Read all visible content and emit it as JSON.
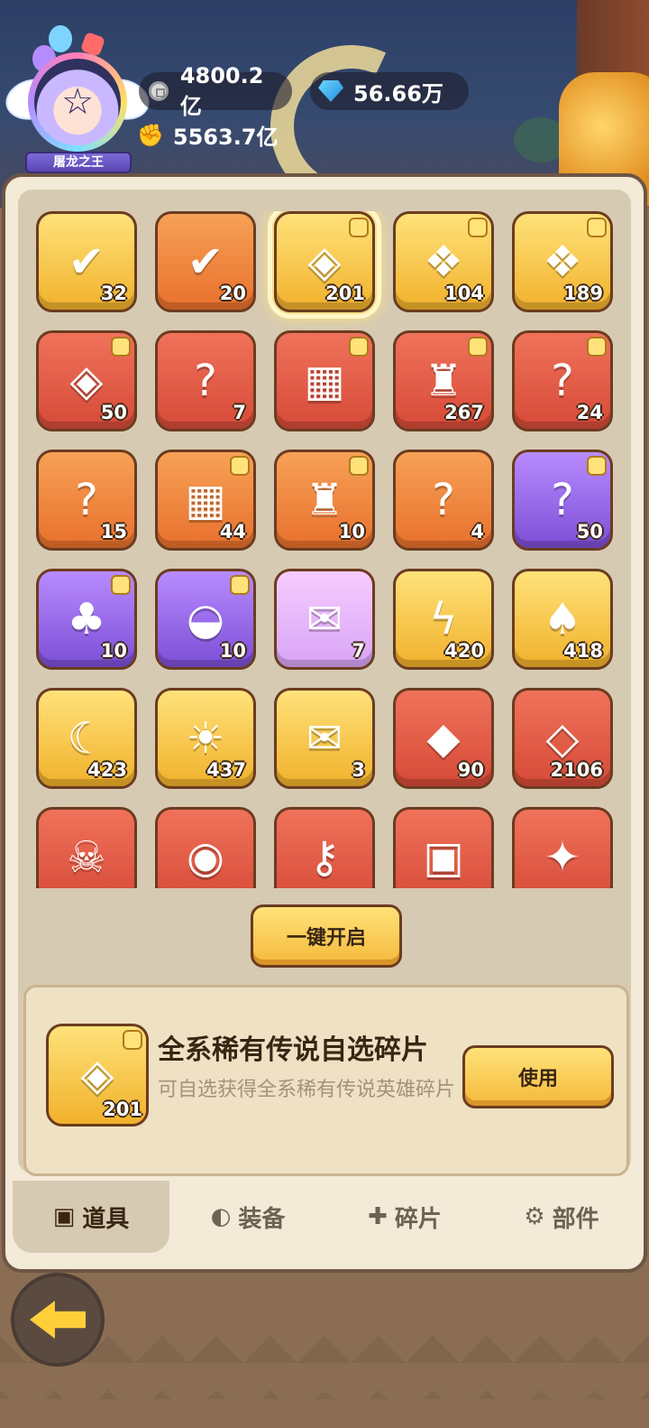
{
  "header": {
    "avatar_title": "屠龙之王",
    "coins": "4800.2亿",
    "gems": "56.66万",
    "power": "5563.7亿"
  },
  "items": [
    {
      "icon": "ticket-chest-icon",
      "count": "32",
      "color": "gold"
    },
    {
      "icon": "purple-ticket-chest-icon",
      "count": "20",
      "color": "orange"
    },
    {
      "icon": "rainbow-card-icon",
      "count": "201",
      "color": "gold",
      "selected": true
    },
    {
      "icon": "gift-box-icon",
      "count": "104",
      "color": "gold"
    },
    {
      "icon": "gift-box-icon",
      "count": "189",
      "color": "gold"
    },
    {
      "icon": "card-pack-icon",
      "count": "50",
      "color": "red"
    },
    {
      "icon": "mystery-sack-icon",
      "count": "7",
      "color": "red"
    },
    {
      "icon": "tech-base-icon",
      "count": "",
      "color": "red"
    },
    {
      "icon": "puzzle-piece-icon",
      "count": "267",
      "color": "red"
    },
    {
      "icon": "mystery-chest-icon",
      "count": "24",
      "color": "red"
    },
    {
      "icon": "mystery-sack-icon",
      "count": "15",
      "color": "orange"
    },
    {
      "icon": "grid-net-icon",
      "count": "44",
      "color": "orange"
    },
    {
      "icon": "puzzle-piece-icon",
      "count": "10",
      "color": "orange"
    },
    {
      "icon": "mystery-chest-icon",
      "count": "4",
      "color": "orange"
    },
    {
      "icon": "mystery-sack-icon",
      "count": "50",
      "color": "purple"
    },
    {
      "icon": "jungle-scene-icon",
      "count": "10",
      "color": "purple"
    },
    {
      "icon": "picnic-scene-icon",
      "count": "10",
      "color": "purple"
    },
    {
      "icon": "rainbow-charm-icon",
      "count": "7",
      "color": "pink"
    },
    {
      "icon": "lightning-leaf-icon",
      "count": "420",
      "color": "gold"
    },
    {
      "icon": "nature-leaf-icon",
      "count": "418",
      "color": "gold"
    },
    {
      "icon": "moon-leaf-icon",
      "count": "423",
      "color": "gold"
    },
    {
      "icon": "sun-leaf-icon",
      "count": "437",
      "color": "gold"
    },
    {
      "icon": "gold-charm-icon",
      "count": "3",
      "color": "gold"
    },
    {
      "icon": "rainbow-gem-icon",
      "count": "90",
      "color": "red"
    },
    {
      "icon": "blue-crystal-icon",
      "count": "2106",
      "color": "red"
    },
    {
      "icon": "bull-skull-icon",
      "count": "",
      "color": "red"
    },
    {
      "icon": "spiral-shield-icon",
      "count": "",
      "color": "red"
    },
    {
      "icon": "golden-key-icon",
      "count": "",
      "color": "red"
    },
    {
      "icon": "supply-crate-icon",
      "count": "",
      "color": "red"
    },
    {
      "icon": "golden-compass-icon",
      "count": "",
      "color": "red"
    }
  ],
  "actions": {
    "open_all_label": "一键开启",
    "use_label": "使用"
  },
  "detail": {
    "name": "全系稀有传说自选碎片",
    "description": "可自选获得全系稀有传说英雄碎片",
    "count": "201"
  },
  "tabs": [
    {
      "label": "道具",
      "icon": "item-icon"
    },
    {
      "label": "装备",
      "icon": "shield-icon"
    },
    {
      "label": "碎片",
      "icon": "puzzle-icon"
    },
    {
      "label": "部件",
      "icon": "gear-icon"
    }
  ],
  "colors": {
    "gold": "#f1b12b",
    "orange": "#e8702d",
    "red": "#d64a38",
    "purple": "#7c4ed6",
    "button": "#f5b93a"
  }
}
